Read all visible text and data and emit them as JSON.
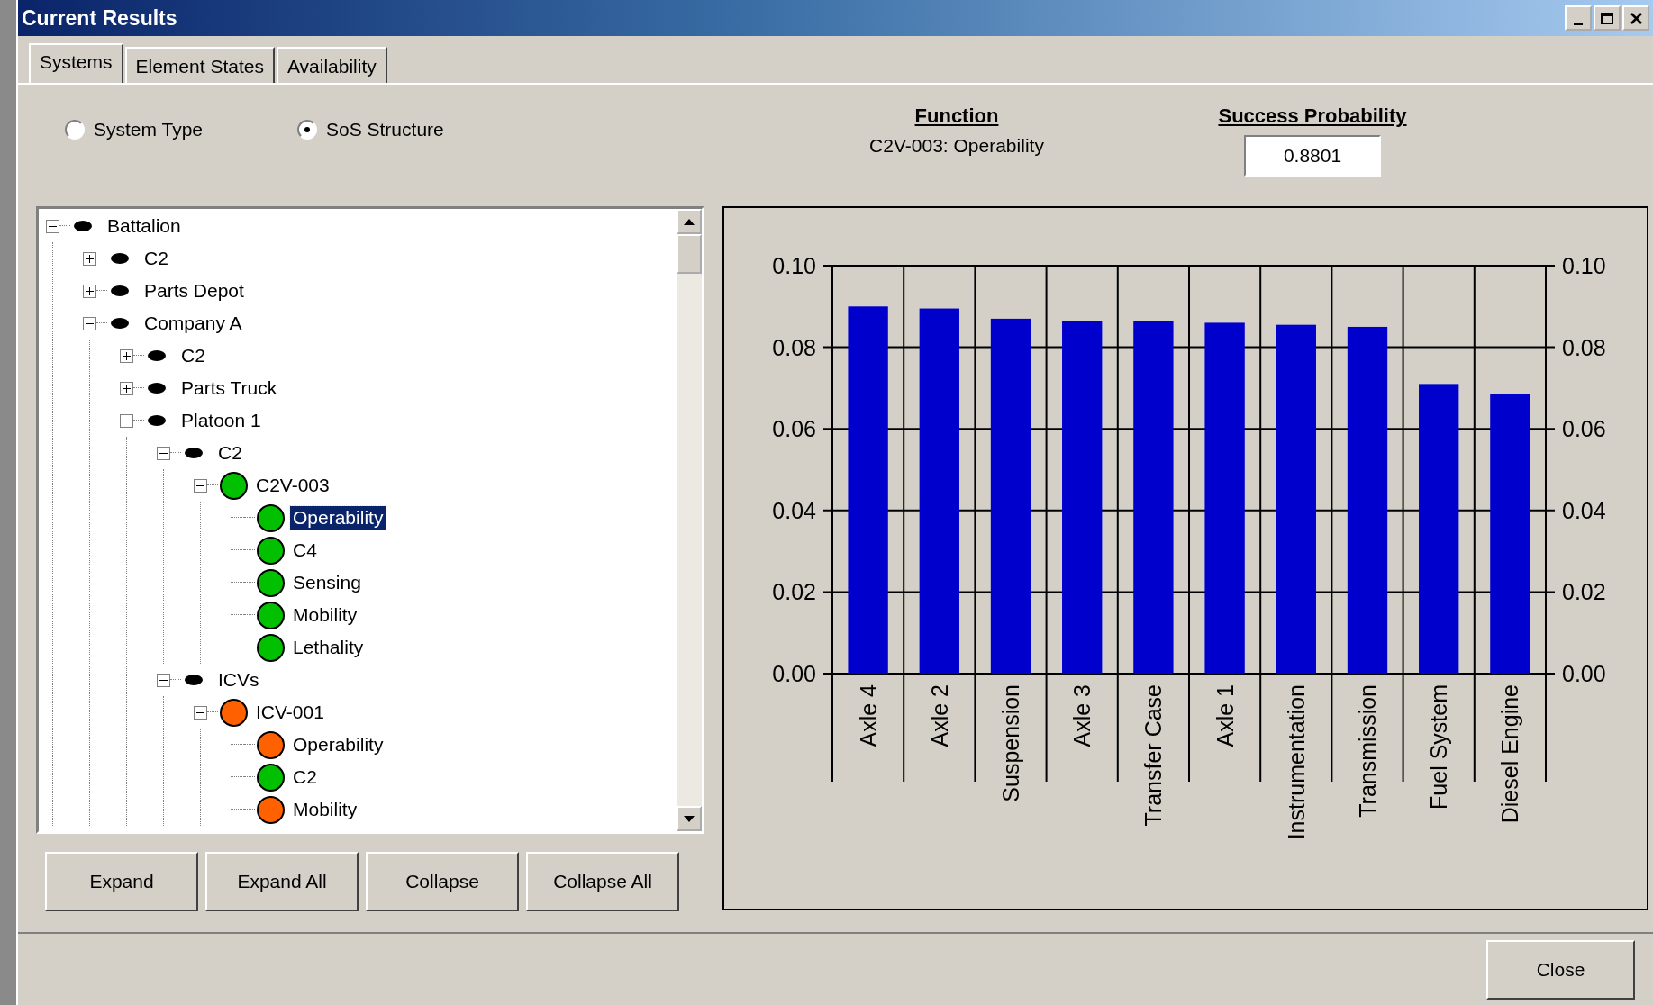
{
  "window": {
    "title": "Current Results"
  },
  "tabs": [
    {
      "label": "Systems",
      "selected": true
    },
    {
      "label": "Element States",
      "selected": false
    },
    {
      "label": "Availability",
      "selected": false
    }
  ],
  "view_options": [
    {
      "label": "System Type",
      "selected": false
    },
    {
      "label": "SoS Structure",
      "selected": true
    }
  ],
  "function": {
    "heading": "Function",
    "value": "C2V-003: Operability"
  },
  "success_probability": {
    "heading": "Success Probability",
    "value": "0.8801"
  },
  "tree": [
    {
      "label": "Battalion",
      "kind": "group",
      "expanded": true,
      "selected": false,
      "children": [
        {
          "label": "C2",
          "kind": "group",
          "expanded": false,
          "selected": false
        },
        {
          "label": "Parts Depot",
          "kind": "group",
          "expanded": false,
          "selected": false
        },
        {
          "label": "Company A",
          "kind": "group",
          "expanded": true,
          "selected": false,
          "children": [
            {
              "label": "C2",
              "kind": "group",
              "expanded": false,
              "selected": false
            },
            {
              "label": "Parts Truck",
              "kind": "group",
              "expanded": false,
              "selected": false
            },
            {
              "label": "Platoon 1",
              "kind": "group",
              "expanded": true,
              "selected": false,
              "children": [
                {
                  "label": "C2",
                  "kind": "group",
                  "expanded": true,
                  "selected": false,
                  "children": [
                    {
                      "label": "C2V-003",
                      "kind": "status",
                      "color": "#00c000",
                      "expanded": true,
                      "selected": false,
                      "children": [
                        {
                          "label": "Operability",
                          "kind": "status",
                          "color": "#00c000",
                          "selected": true
                        },
                        {
                          "label": "C4",
                          "kind": "status",
                          "color": "#00c000",
                          "selected": false
                        },
                        {
                          "label": "Sensing",
                          "kind": "status",
                          "color": "#00c000",
                          "selected": false
                        },
                        {
                          "label": "Mobility",
                          "kind": "status",
                          "color": "#00c000",
                          "selected": false
                        },
                        {
                          "label": "Lethality",
                          "kind": "status",
                          "color": "#00c000",
                          "selected": false
                        }
                      ]
                    }
                  ]
                },
                {
                  "label": "ICVs",
                  "kind": "group",
                  "expanded": true,
                  "selected": false,
                  "children": [
                    {
                      "label": "ICV-001",
                      "kind": "status",
                      "color": "#ff6000",
                      "expanded": true,
                      "selected": false,
                      "children": [
                        {
                          "label": "Operability",
                          "kind": "status",
                          "color": "#ff6000",
                          "selected": false
                        },
                        {
                          "label": "C2",
                          "kind": "status",
                          "color": "#00c000",
                          "selected": false
                        },
                        {
                          "label": "Mobility",
                          "kind": "status",
                          "color": "#ff6000",
                          "selected": false
                        }
                      ]
                    }
                  ]
                }
              ]
            }
          ]
        }
      ]
    }
  ],
  "tree_buttons": [
    "Expand",
    "Expand All",
    "Collapse",
    "Collapse All"
  ],
  "chart_data": {
    "type": "bar",
    "categories": [
      "Axle 4",
      "Axle 2",
      "Suspension",
      "Axle 3",
      "Transfer Case",
      "Axle 1",
      "Instrumentation",
      "Transmission",
      "Fuel System",
      "Diesel Engine"
    ],
    "series": [
      {
        "color": "#0000cc",
        "values": [
          0.09,
          0.0895,
          0.087,
          0.0865,
          0.0865,
          0.086,
          0.0855,
          0.085,
          0.071,
          0.0685
        ]
      }
    ],
    "grid": true,
    "ylim": [
      0,
      0.1
    ],
    "yticks": [
      {
        "value": 0,
        "label": "0.00"
      },
      {
        "value": 0.02,
        "label": "0.02"
      },
      {
        "value": 0.04,
        "label": "0.04"
      },
      {
        "value": 0.06,
        "label": "0.06"
      },
      {
        "value": 0.08,
        "label": "0.08"
      },
      {
        "value": 0.1,
        "label": "0.10"
      }
    ]
  },
  "buttons": [
    "Close"
  ]
}
